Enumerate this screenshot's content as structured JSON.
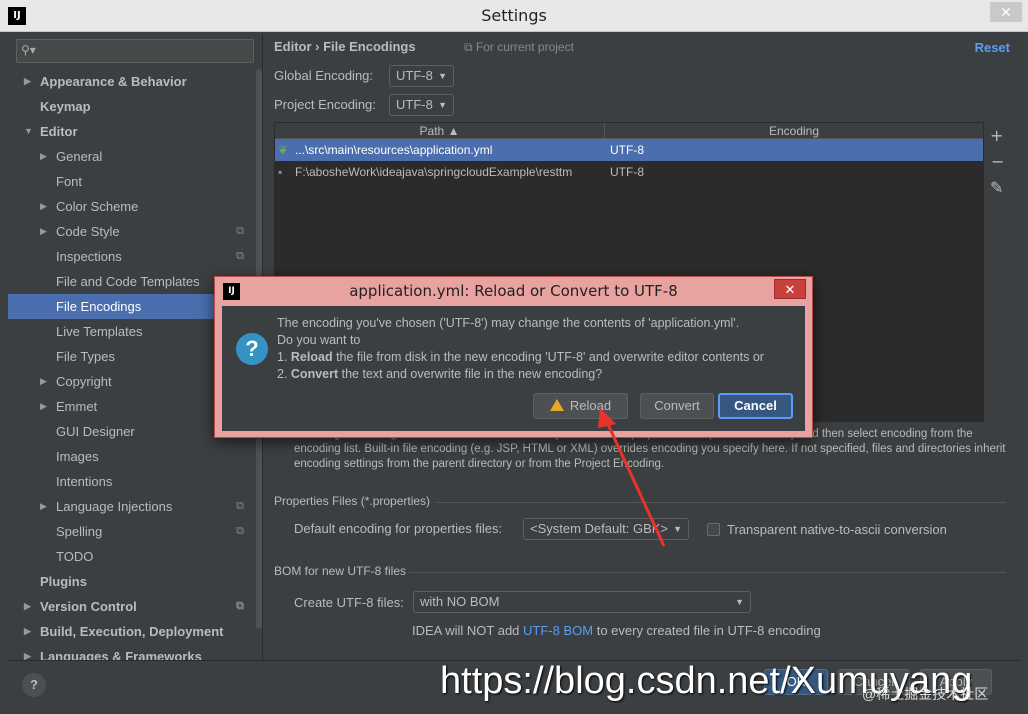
{
  "window": {
    "title": "Settings",
    "icon_text": "IJ",
    "close_label": "✕"
  },
  "sidebar": {
    "search_placeholder": "",
    "items": [
      {
        "label": "Appearance & Behavior",
        "level": 0,
        "bold": true,
        "arrow": "▶"
      },
      {
        "label": "Keymap",
        "level": 0,
        "bold": true,
        "arrow": ""
      },
      {
        "label": "Editor",
        "level": 0,
        "bold": true,
        "arrow": "▼"
      },
      {
        "label": "General",
        "level": 1,
        "arrow": "▶"
      },
      {
        "label": "Font",
        "level": 1,
        "arrow": ""
      },
      {
        "label": "Color Scheme",
        "level": 1,
        "arrow": "▶"
      },
      {
        "label": "Code Style",
        "level": 1,
        "arrow": "▶",
        "proj": true
      },
      {
        "label": "Inspections",
        "level": 1,
        "arrow": "",
        "proj": true
      },
      {
        "label": "File and Code Templates",
        "level": 1,
        "arrow": "",
        "proj": true
      },
      {
        "label": "File Encodings",
        "level": 1,
        "arrow": "",
        "proj": true,
        "selected": true
      },
      {
        "label": "Live Templates",
        "level": 1,
        "arrow": ""
      },
      {
        "label": "File Types",
        "level": 1,
        "arrow": ""
      },
      {
        "label": "Copyright",
        "level": 1,
        "arrow": "▶",
        "proj": true
      },
      {
        "label": "Emmet",
        "level": 1,
        "arrow": "▶"
      },
      {
        "label": "GUI Designer",
        "level": 1,
        "arrow": "",
        "proj": true
      },
      {
        "label": "Images",
        "level": 1,
        "arrow": ""
      },
      {
        "label": "Intentions",
        "level": 1,
        "arrow": ""
      },
      {
        "label": "Language Injections",
        "level": 1,
        "arrow": "▶",
        "proj": true
      },
      {
        "label": "Spelling",
        "level": 1,
        "arrow": "",
        "proj": true
      },
      {
        "label": "TODO",
        "level": 1,
        "arrow": ""
      },
      {
        "label": "Plugins",
        "level": 0,
        "bold": true,
        "arrow": ""
      },
      {
        "label": "Version Control",
        "level": 0,
        "bold": true,
        "arrow": "▶",
        "proj": true
      },
      {
        "label": "Build, Execution, Deployment",
        "level": 0,
        "bold": true,
        "arrow": "▶"
      },
      {
        "label": "Languages & Frameworks",
        "level": 0,
        "bold": true,
        "arrow": "▶"
      }
    ]
  },
  "main": {
    "breadcrumb": "Editor › File Encodings",
    "current_project": "For current project",
    "reset_label": "Reset",
    "global_encoding_label": "Global Encoding:",
    "global_encoding_value": "UTF-8",
    "project_encoding_label": "Project Encoding:",
    "project_encoding_value": "UTF-8",
    "table": {
      "col_path": "Path ▲",
      "col_encoding": "Encoding",
      "rows": [
        {
          "path": "...\\src\\main\\resources\\application.yml",
          "encoding": "UTF-8",
          "selected": true
        },
        {
          "path": "F:\\abosheWork\\ideajava\\springcloudExample\\resttm",
          "encoding": "UTF-8",
          "selected": false
        }
      ]
    },
    "help_text": "To change encoding of an IDE-based file, a directory, or the entire project, add its path if necessary and then select encoding from the encoding list. Built-in file encoding (e.g. JSP, HTML or XML) overrides encoding you specify here. If not specified, files and directories inherit encoding settings from the parent directory or from the Project Encoding.",
    "properties_section": "Properties Files (*.properties)",
    "default_props_label": "Default encoding for properties files:",
    "default_props_value": "<System Default: GBK>",
    "transparent_label": "Transparent native-to-ascii conversion",
    "bom_section": "BOM for new UTF-8 files",
    "create_utf8_label": "Create UTF-8 files:",
    "create_utf8_value": "with NO BOM",
    "bom_note_pre": "IDEA will NOT add ",
    "bom_note_link": "UTF-8 BOM",
    "bom_note_post": " to every created file in UTF-8 encoding"
  },
  "dialog": {
    "title": "application.yml: Reload or Convert to UTF-8",
    "icon_text": "IJ",
    "close_label": "✕",
    "line1": "The encoding you've chosen ('UTF-8') may change the contents of 'application.yml'.",
    "line2": "Do you want to",
    "line3_num": "1. ",
    "line3_bold": "Reload",
    "line3_rest": " the file from disk in the new encoding 'UTF-8' and overwrite editor contents or",
    "line4_num": "2. ",
    "line4_bold": "Convert",
    "line4_rest": " the text and overwrite file in the new encoding?",
    "reload_label": "Reload",
    "convert_label": "Convert",
    "cancel_label": "Cancel"
  },
  "footer": {
    "help_label": "?",
    "ok_label": "OK",
    "cancel_label": "Cancel",
    "apply_label": "Apply"
  },
  "watermark": {
    "url": "https://blog.csdn.net/Xumuyang",
    "secondary": "@稀土掘金技术社区"
  }
}
